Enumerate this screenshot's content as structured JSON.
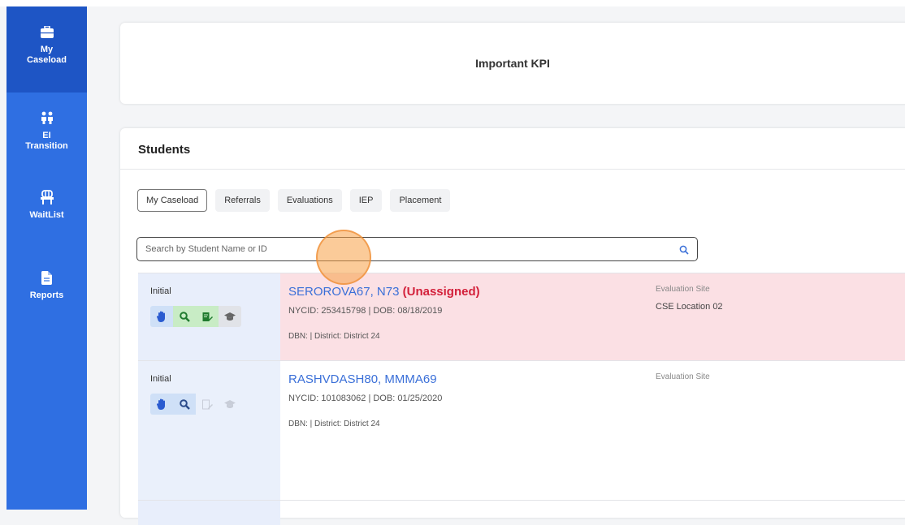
{
  "sidebar": {
    "items": [
      {
        "label": "My\nCaseload",
        "icon": "briefcase-icon",
        "active": true
      },
      {
        "label": "EI\nTransition",
        "icon": "people-icon",
        "active": false
      },
      {
        "label": "WaitList",
        "icon": "chair-icon",
        "active": false
      },
      {
        "label": "Reports",
        "icon": "document-icon",
        "active": false
      }
    ]
  },
  "kpi": {
    "title": "Important KPI"
  },
  "students": {
    "title": "Students",
    "tabs": [
      {
        "label": "My Caseload",
        "active": true
      },
      {
        "label": "Referrals",
        "active": false
      },
      {
        "label": "Evaluations",
        "active": false
      },
      {
        "label": "IEP",
        "active": false
      },
      {
        "label": "Placement",
        "active": false
      }
    ],
    "search": {
      "placeholder": "Search by Student Name or ID",
      "value": ""
    },
    "rows": [
      {
        "stage": "Initial",
        "name": "SEROROVA67, N73",
        "flag": "(Unassigned)",
        "meta1": "NYCID: 253415798 | DOB: 08/18/2019",
        "meta2": "DBN: | District: District 24",
        "eval_label": "Evaluation Site",
        "eval_value": "CSE Location 02"
      },
      {
        "stage": "Initial",
        "name": "RASHVDASH80, MMMA69",
        "flag": "",
        "meta1": "NYCID: 101083062 | DOB: 01/25/2020",
        "meta2": "DBN: | District: District 24",
        "eval_label": "Evaluation Site",
        "eval_value": ""
      }
    ]
  },
  "colors": {
    "sidebar": "#2f6fe2",
    "sidebar_active": "#1e55c5",
    "link": "#3a6fd8",
    "unassigned": "#d3203a",
    "row_highlight": "#fbe0e4"
  }
}
